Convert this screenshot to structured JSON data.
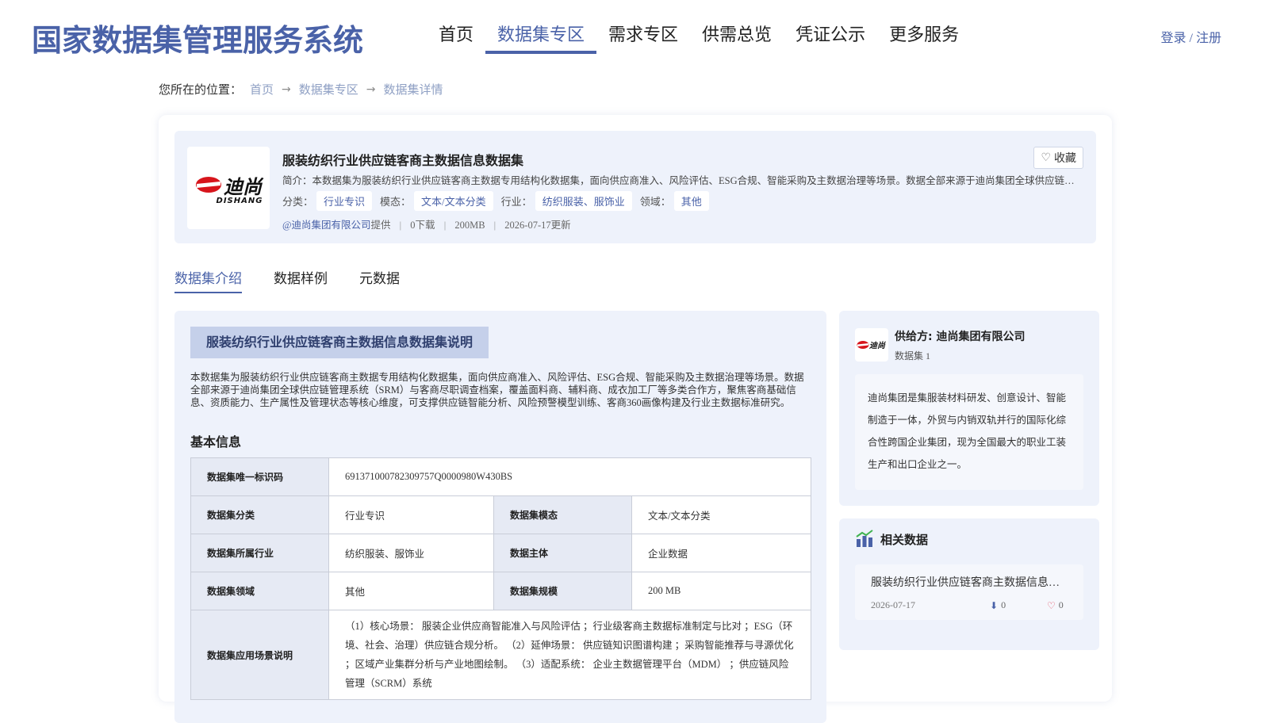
{
  "header": {
    "site_title": "国家数据集管理服务系统",
    "nav": [
      "首页",
      "数据集专区",
      "需求专区",
      "供需总览",
      "凭证公示",
      "更多服务"
    ],
    "auth": "登录 / 注册"
  },
  "breadcrumb": {
    "label": "您所在的位置：",
    "items": [
      "首页",
      "数据集专区",
      "数据集详情"
    ]
  },
  "summary": {
    "logo_cn": "迪尚",
    "logo_en": "DISHANG",
    "title": "服装纺织行业供应链客商主数据信息数据集",
    "favorite": "收藏",
    "intro": "简介：本数据集为服装纺织行业供应链客商主数据专用结构化数据集，面向供应商准入、风险评估、ESG合规、智能采购及主数据治理等场景。数据全部来源于迪尚集团全球供应链管理系统（SRM）与客商尽职调查档案，覆盖面料商、辅料商、成衣加工厂等多类合作方",
    "tags": [
      {
        "label": "分类：",
        "value": "行业专识"
      },
      {
        "label": "模态：",
        "value": "文本/文本分类"
      },
      {
        "label": "行业：",
        "value": "纺织服装、服饰业"
      },
      {
        "label": "领域：",
        "value": "其他"
      }
    ],
    "provider": "@迪尚集团有限公司",
    "provide_suffix": "提供",
    "downloads": "0下载",
    "size": "200MB",
    "updated": "2026-07-17更新"
  },
  "tabs": [
    "数据集介绍",
    "数据样例",
    "元数据"
  ],
  "content": {
    "section_title": "服装纺织行业供应链客商主数据信息数据集说明",
    "description": "本数据集为服装纺织行业供应链客商主数据专用结构化数据集，面向供应商准入、风险评估、ESG合规、智能采购及主数据治理等场景。数据全部来源于迪尚集团全球供应链管理系统（SRM）与客商尽职调查档案，覆盖面料商、辅料商、成衣加工厂等多类合作方，聚焦客商基础信息、资质能力、生产属性及管理状态等核心维度，可支撑供应链智能分析、风险预警模型训练、客商360画像构建及行业主数据标准研究。",
    "basic_title": "基本信息",
    "rows": {
      "id_k": "数据集唯一标识码",
      "id_v": "691371000782309757Q0000980W430BS",
      "cat_k": "数据集分类",
      "cat_v": "行业专识",
      "mod_k": "数据集模态",
      "mod_v": "文本/文本分类",
      "ind_k": "数据集所属行业",
      "ind_v": "纺织服装、服饰业",
      "sub_k": "数据主体",
      "sub_v": "企业数据",
      "dom_k": "数据集领域",
      "dom_v": "其他",
      "scale_k": "数据集规模",
      "scale_v": "200 MB",
      "scene_k": "数据集应用场景说明",
      "scene_v": "（1）核心场景： 服装企业供应商智能准入与风险评估 ；行业级客商主数据标准制定与比对 ；ESG（环境、社会、治理）供应链合规分析。 （2）延伸场景： 供应链知识图谱构建 ；采购智能推荐与寻源优化 ；区域产业集群分析与产业地图绘制。 （3）适配系统： 企业主数据管理平台（MDM） ；供应链风险管理（SCRM）系统"
    }
  },
  "provider_card": {
    "name": "供给方: 迪尚集团有限公司",
    "count": "数据集 1",
    "desc": "迪尚集团是集服装材料研发、创意设计、智能制造于一体，外贸与内销双轨并行的国际化综合性跨国企业集团，现为全国最大的职业工装生产和出口企业之一。"
  },
  "related": {
    "title": "相关数据",
    "item_title": "服装纺织行业供应链客商主数据信息数据集",
    "item_date": "2026-07-17",
    "item_downloads": "0",
    "item_favorites": "0"
  },
  "colors": {
    "accent": "#4a62a8",
    "logo_red": "#d7151c"
  }
}
